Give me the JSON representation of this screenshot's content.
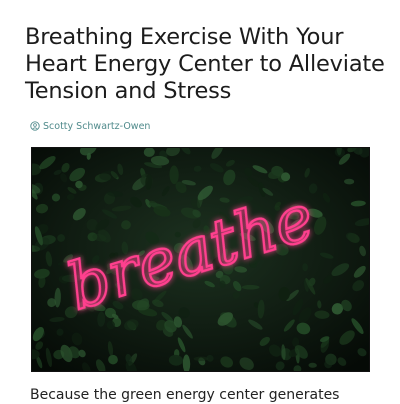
{
  "article": {
    "title": "Breathing Exercise With Your Heart Energy Center to Alleviate Tension and Stress",
    "author": "Scotty Schwartz-Owen",
    "author_icon": "user-circle-icon",
    "hero_image": {
      "neon_text": "breathe",
      "neon_color": "#ff3f8e",
      "background_color": "#0b150e"
    },
    "body_intro": "Because the green energy center generates"
  },
  "colors": {
    "accent": "#4f8a8b",
    "text": "#1c1c1c"
  }
}
